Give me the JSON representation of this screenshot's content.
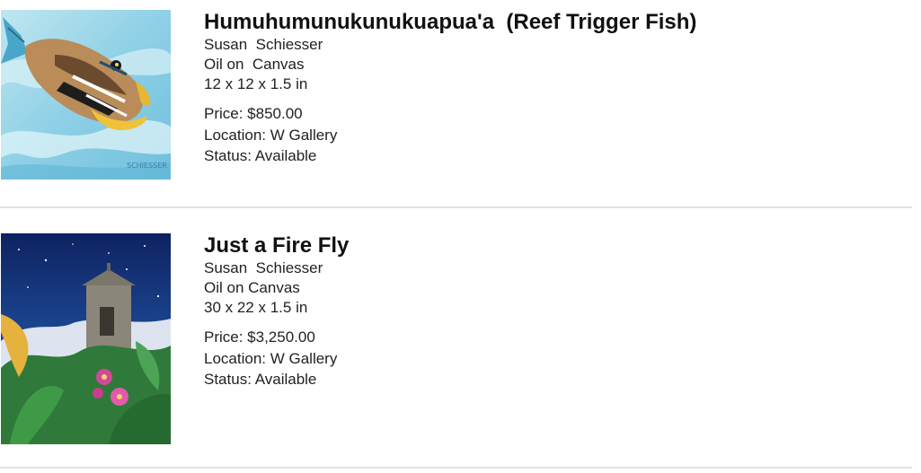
{
  "listings": [
    {
      "image_subject": "reef-trigger-fish-painting",
      "title": "Humuhumunukunukuapua'a  (Reef Trigger Fish)",
      "artist": "Susan  Schiesser",
      "medium": "Oil on  Canvas",
      "dimensions": "12 x 12 x 1.5 in",
      "price": "Price: $850.00",
      "location": "Location: W Gallery",
      "status": "Status: Available"
    },
    {
      "image_subject": "fire-fly-tower-night-painting",
      "title": "Just a Fire Fly",
      "artist": "Susan  Schiesser",
      "medium": "Oil on Canvas",
      "dimensions": "30 x 22 x 1.5 in",
      "price": "Price: $3,250.00",
      "location": "Location: W Gallery",
      "status": "Status: Available"
    }
  ],
  "colors": {
    "divider": "#e2e2e2",
    "text": "#222222"
  }
}
